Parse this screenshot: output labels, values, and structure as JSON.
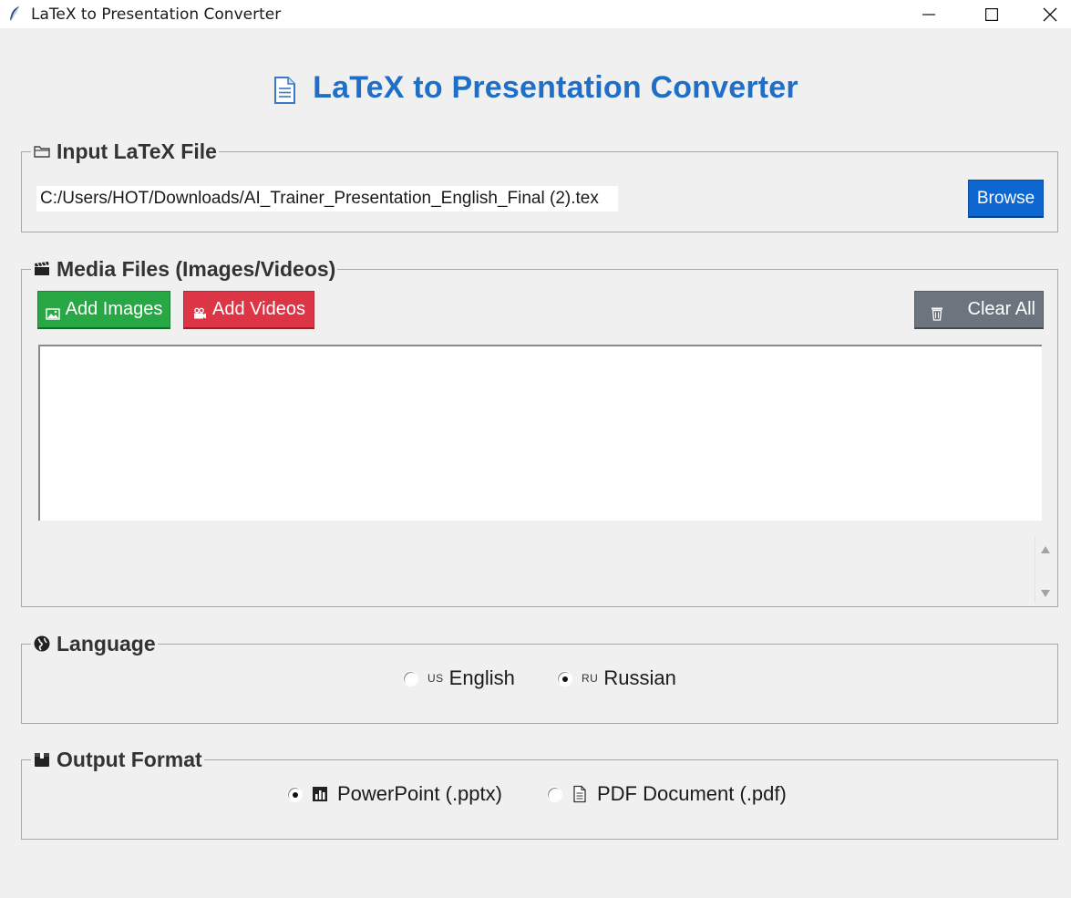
{
  "window": {
    "title": "LaTeX to Presentation Converter",
    "icon": "feather-icon"
  },
  "header": {
    "title": "LaTeX to Presentation Converter",
    "icon": "document-icon",
    "color": "#1f6fc9"
  },
  "input_section": {
    "legend": "Input LaTeX File",
    "icon": "folder-icon",
    "file_path": "C:/Users/HOT/Downloads/AI_Trainer_Presentation_English_Final (2).tex",
    "browse_label": "Browse",
    "browse_color": "#0d67d0"
  },
  "media_section": {
    "legend": "Media Files (Images/Videos)",
    "icon": "clapperboard-icon",
    "add_images_label": "Add Images",
    "add_images_color": "#27a844",
    "add_videos_label": "Add Videos",
    "add_videos_color": "#dc3545",
    "clear_all_label": "Clear All",
    "clear_all_color": "#6c757d",
    "items": []
  },
  "language_section": {
    "legend": "Language",
    "icon": "globe-icon",
    "options": [
      {
        "code": "US",
        "label": "English",
        "selected": false
      },
      {
        "code": "RU",
        "label": "Russian",
        "selected": true
      }
    ]
  },
  "output_section": {
    "legend": "Output Format",
    "icon": "package-icon",
    "options": [
      {
        "label": "PowerPoint (.pptx)",
        "icon": "bar-chart-icon",
        "selected": true
      },
      {
        "label": "PDF Document (.pdf)",
        "icon": "page-icon",
        "selected": false
      }
    ]
  }
}
